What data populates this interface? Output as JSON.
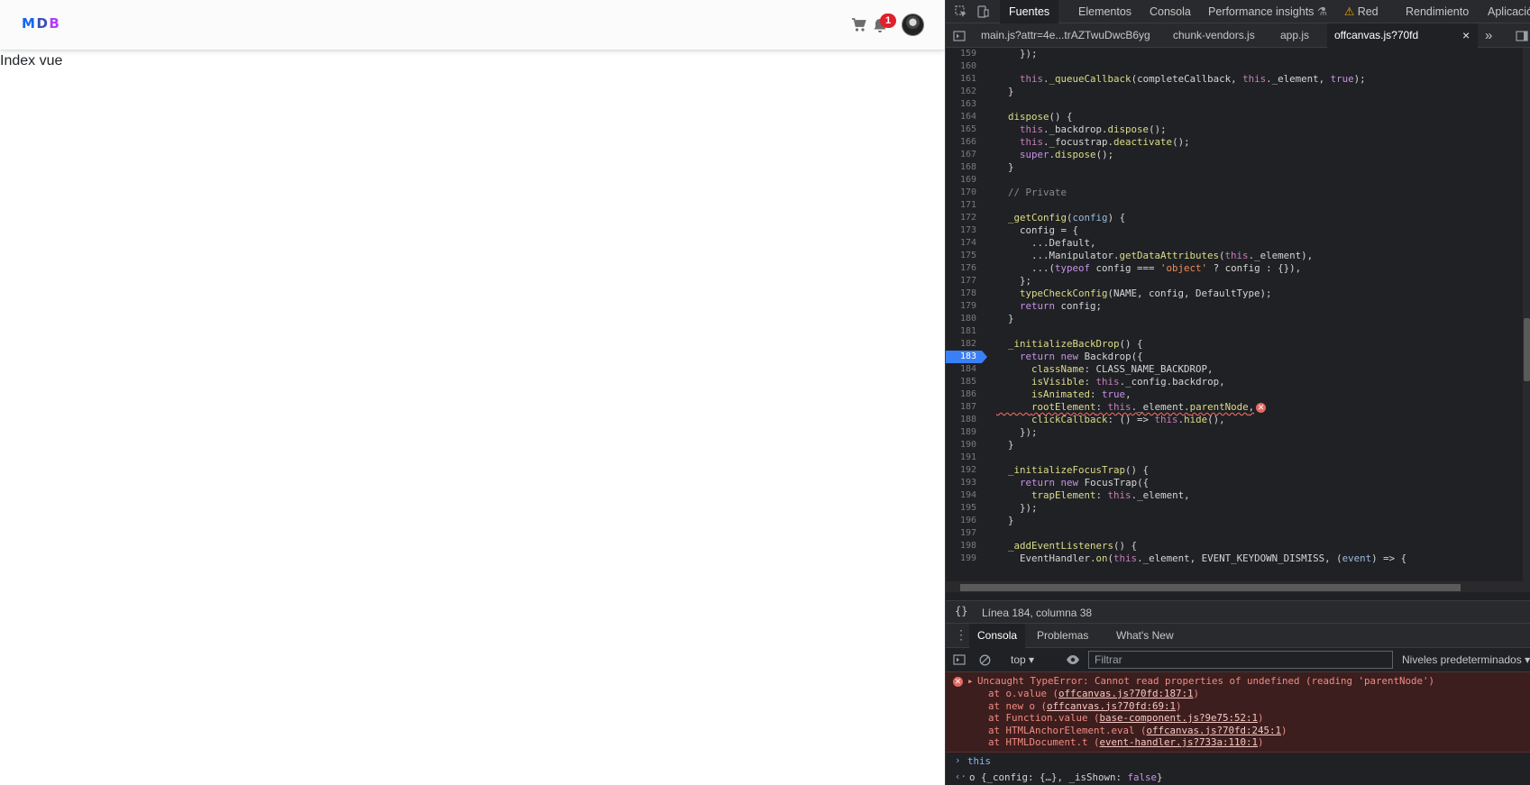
{
  "page": {
    "logo": {
      "m": "M",
      "d": "D",
      "b": "B"
    },
    "cart_icon": "cart-icon",
    "bell_icon": "bell-icon",
    "notification_count": "1",
    "body_text": "Index vue"
  },
  "devtools": {
    "tabs": [
      "Fuentes",
      "Elementos",
      "Consola",
      "Performance insights",
      "Red",
      "Rendimiento",
      "Aplicació"
    ],
    "active_tab": "Fuentes",
    "file_tabs": [
      "main.js?attr=4e...trAZTwuDwcB6yg",
      "chunk-vendors.js",
      "app.js",
      "offcanvas.js?70fd"
    ],
    "active_file": "offcanvas.js?70fd",
    "close_glyph": "×",
    "more_glyph": "»",
    "line_numbers": [
      "159",
      "160",
      "161",
      "162",
      "163",
      "164",
      "165",
      "166",
      "167",
      "168",
      "169",
      "170",
      "171",
      "172",
      "173",
      "174",
      "175",
      "176",
      "177",
      "178",
      "179",
      "180",
      "181",
      "182",
      "183",
      "184",
      "185",
      "186",
      "187",
      "188",
      "189",
      "190",
      "191",
      "192",
      "193",
      "194",
      "195",
      "196",
      "197",
      "198",
      "199"
    ],
    "breakpoint_line": "183",
    "status_text": "Línea 184, columna 38",
    "pretty_print": "{}",
    "drawer_tabs": [
      "Consola",
      "Problemas",
      "What's New"
    ],
    "console_context": "top ▾",
    "filter_placeholder": "Filtrar",
    "levels": "Niveles predeterminados ▾",
    "error": {
      "message": "Uncaught TypeError: Cannot read properties of undefined (reading 'parentNode')",
      "stack": [
        {
          "at": "at o.value (",
          "link": "offcanvas.js?70fd:187:1",
          "end": ")"
        },
        {
          "at": "at new o (",
          "link": "offcanvas.js?70fd:69:1",
          "end": ")"
        },
        {
          "at": "at Function.value (",
          "link": "base-component.js?9e75:52:1",
          "end": ")"
        },
        {
          "at": "at HTMLAnchorElement.eval (",
          "link": "offcanvas.js?70fd:245:1",
          "end": ")"
        },
        {
          "at": "at HTMLDocument.t (",
          "link": "event-handler.js?733a:110:1",
          "end": ")"
        }
      ]
    },
    "console_input": "this",
    "console_result": {
      "prefix": "o {_config: {…}, _isShown: ",
      "value": "false",
      "suffix": "}"
    },
    "colors": {
      "bg": "#202124",
      "breakpoint": "#3a7ff6",
      "error_bg": "#3c1e1e",
      "error_text": "#f28b82"
    }
  }
}
